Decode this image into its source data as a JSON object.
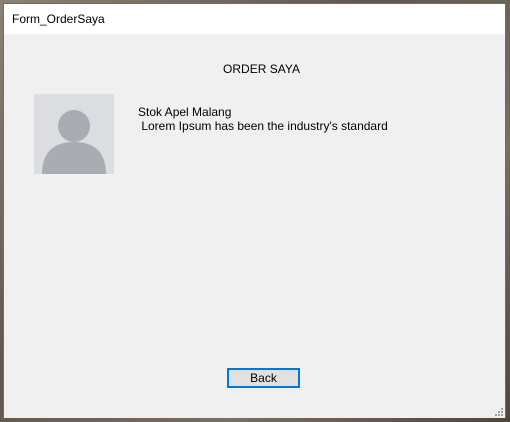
{
  "window": {
    "title": "Form_OrderSaya"
  },
  "main": {
    "heading": "ORDER SAYA",
    "product": {
      "image_icon": "user-placeholder-icon",
      "name": "Stok Apel Malang",
      "description": " Lorem Ipsum has been the industry's standard"
    },
    "back_label": "Back"
  },
  "colors": {
    "accent": "#0078d7",
    "window_border": "#1883d7",
    "form_background": "#f0f0f0",
    "avatar_background": "#dcdde0",
    "avatar_silhouette": "#a9adb3"
  }
}
